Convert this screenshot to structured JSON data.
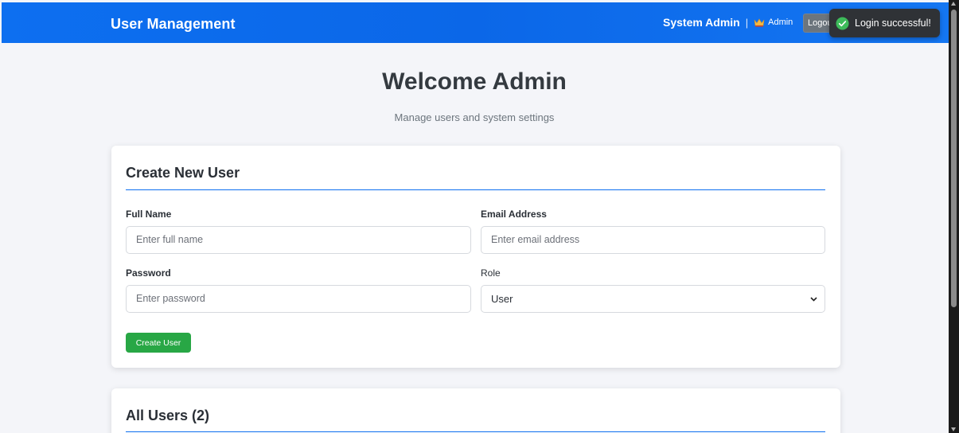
{
  "header": {
    "brand": "User Management",
    "user_name": "System Admin",
    "separator": "|",
    "role_icon": "crown-icon",
    "role": "Admin",
    "logout_label": "Logout"
  },
  "toast": {
    "icon": "check-circle-icon",
    "message": "Login successful!"
  },
  "welcome": {
    "title": "Welcome Admin",
    "subtitle": "Manage users and system settings"
  },
  "create_user": {
    "title": "Create New User",
    "full_name": {
      "label": "Full Name",
      "placeholder": "Enter full name",
      "value": ""
    },
    "email": {
      "label": "Email Address",
      "placeholder": "Enter email address",
      "value": ""
    },
    "password": {
      "label": "Password",
      "placeholder": "Enter password",
      "value": ""
    },
    "role": {
      "label": "Role",
      "selected": "User"
    },
    "submit_label": "Create User"
  },
  "all_users": {
    "title": "All Users (2)"
  },
  "colors": {
    "header": "#0d6ff0",
    "success": "#28a745",
    "logout": "#6c757d",
    "toast_bg": "#2f3236"
  }
}
